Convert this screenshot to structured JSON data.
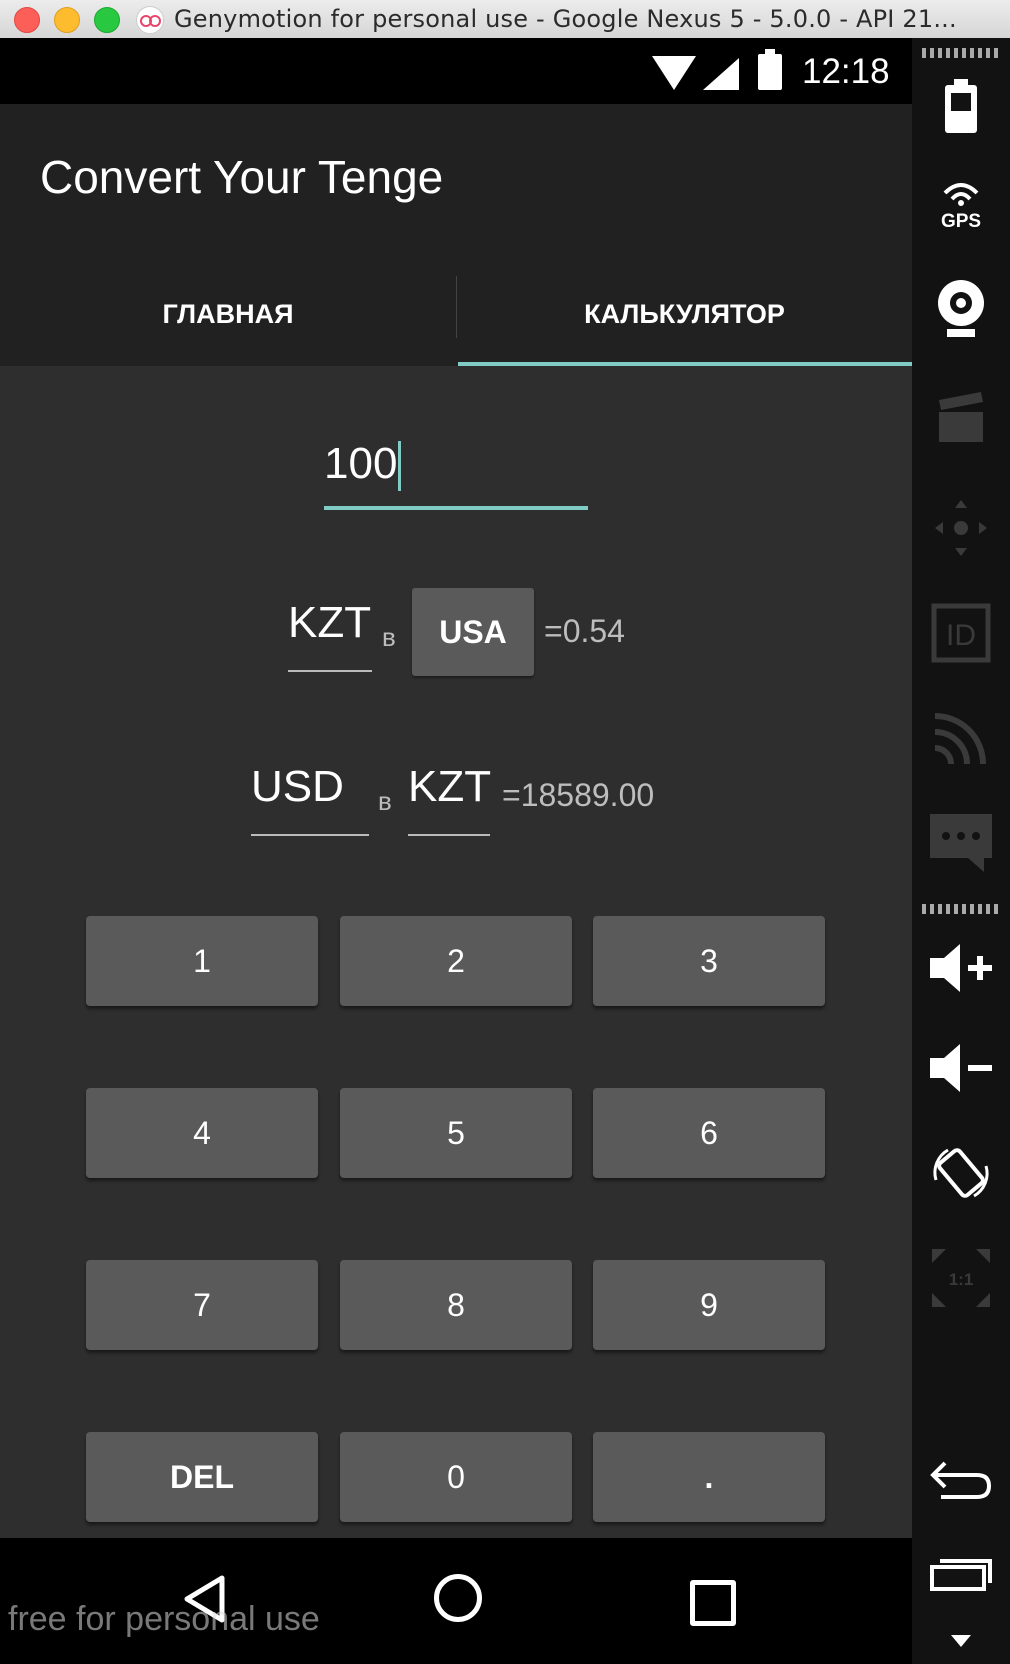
{
  "window": {
    "title": "Genymotion for personal use - Google Nexus 5 - 5.0.0 - API 21..."
  },
  "status_bar": {
    "time": "12:18"
  },
  "app_bar": {
    "title": "Convert Your Tenge"
  },
  "tabs": [
    {
      "label": "ГЛАВНАЯ",
      "selected": false
    },
    {
      "label": "КАЛЬКУЛЯТОР",
      "selected": true
    }
  ],
  "calculator": {
    "amount_value": "100",
    "row1": {
      "from_currency": "KZT",
      "separator": "в",
      "to_button": "USA",
      "result": "=0.54"
    },
    "row2": {
      "from_currency": "USD",
      "separator": "в",
      "to_currency": "KZT",
      "result": "=18589.00"
    },
    "keys": [
      "1",
      "2",
      "3",
      "4",
      "5",
      "6",
      "7",
      "8",
      "9",
      "DEL",
      "0",
      "."
    ]
  },
  "watermark": "free for personal use",
  "sidebar_icons": [
    "battery-icon",
    "gps-icon",
    "webcam-icon",
    "capture-icon",
    "remote-control-icon",
    "device-id-icon",
    "cast-icon",
    "sms-icon",
    "volume-up-icon",
    "volume-down-icon",
    "rotate-icon",
    "scale-icon",
    "back-icon",
    "recent-apps-icon",
    "menu-icon"
  ],
  "colors": {
    "accent": "#80cbc4",
    "app_bar": "#212121",
    "background": "#2e2e2e",
    "button": "#5a5a5a"
  }
}
